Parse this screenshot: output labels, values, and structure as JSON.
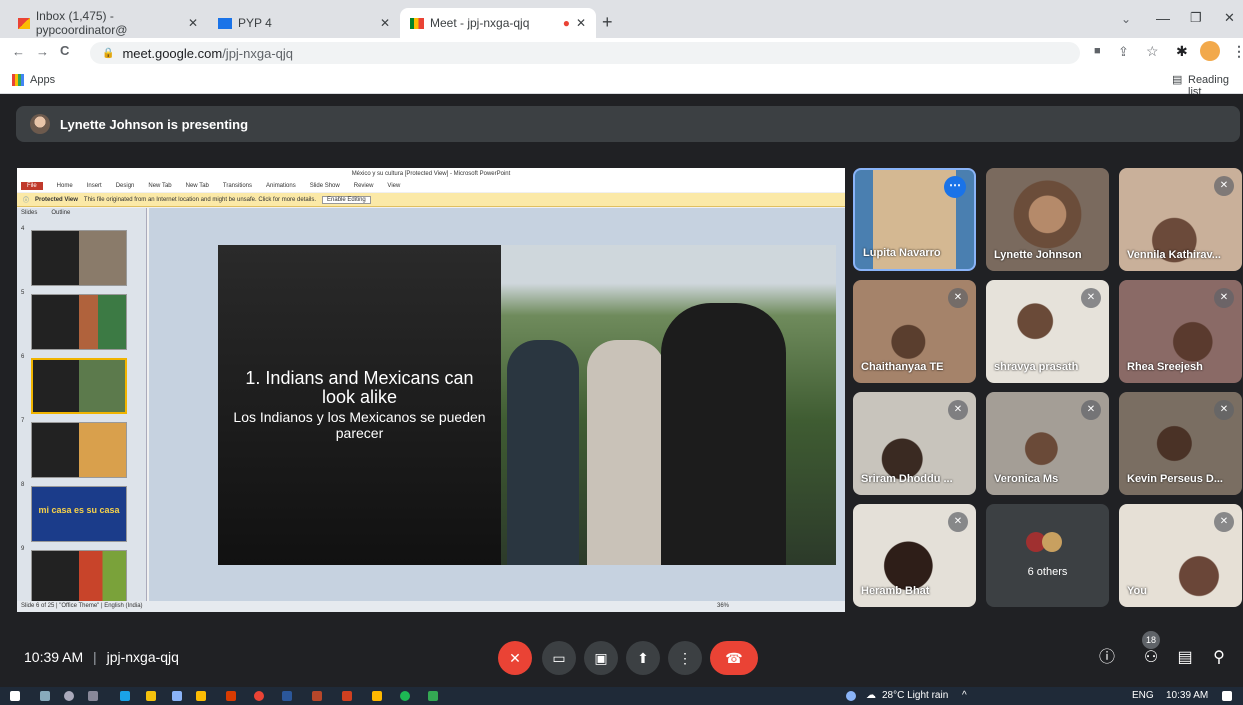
{
  "browser": {
    "tabs": [
      {
        "label": "Inbox (1,475) - pypcoordinator@",
        "icon": "gmail-icon"
      },
      {
        "label": "PYP 4",
        "icon": "slides-icon"
      },
      {
        "label": "Meet - jpj-nxga-qjq",
        "icon": "meet-icon"
      }
    ],
    "new_tab": "+",
    "url_host": "meet.google.com",
    "url_path": "/jpj-nxga-qjq",
    "bookmarks_apps": "Apps",
    "reading_list": "Reading list"
  },
  "meet": {
    "presenting_banner": "Lynette Johnson is presenting",
    "participants": [
      {
        "name": "Lupita Navarro",
        "muted": false
      },
      {
        "name": "Lynette Johnson",
        "muted": false
      },
      {
        "name": "Vennila Kathirav...",
        "muted": true
      },
      {
        "name": "Chaithanyaa TE",
        "muted": true
      },
      {
        "name": "shravya prasath",
        "muted": true
      },
      {
        "name": "Rhea Sreejesh",
        "muted": true
      },
      {
        "name": "Sriram Dhoddu ...",
        "muted": true
      },
      {
        "name": "Veronica Ms",
        "muted": true
      },
      {
        "name": "Kevin Perseus D...",
        "muted": true
      },
      {
        "name": "Heramb Bhat",
        "muted": true
      },
      {
        "name": "6 others",
        "muted": false
      },
      {
        "name": "You",
        "muted": true
      }
    ],
    "time": "10:39 AM",
    "separator": "|",
    "meeting_code": "jpj-nxga-qjq",
    "people_count": "18"
  },
  "ppt": {
    "title": "México y su cultura [Protected View] - Microsoft PowerPoint",
    "ribbon_tabs": [
      "File",
      "Home",
      "Insert",
      "Design",
      "New Tab",
      "New Tab",
      "Transitions",
      "Animations",
      "Slide Show",
      "Review",
      "View"
    ],
    "protected_label": "Protected View",
    "protected_msg": "This file originated from an Internet location and might be unsafe. Click for more details.",
    "enable_editing": "Enable Editing",
    "panel_tabs": [
      "Slides",
      "Outline"
    ],
    "slide_numbers": [
      "4",
      "5",
      "6",
      "7",
      "8",
      "9"
    ],
    "thumb8_text": "mi casa es su casa",
    "slide_heading": "1. Indians and Mexicans can look alike",
    "slide_subheading": "Los Indianos y los Mexicanos se pueden parecer",
    "status": "Slide 6 of 25  |  \"Office Theme\"  |  English (India)",
    "zoom": "36%"
  },
  "taskbar": {
    "weather": "28°C  Light rain",
    "lang": "ENG",
    "clock": "10:39 AM"
  },
  "colors": {
    "meet_bg": "#202124",
    "end_call": "#ea4335",
    "accent": "#1a73e8"
  }
}
